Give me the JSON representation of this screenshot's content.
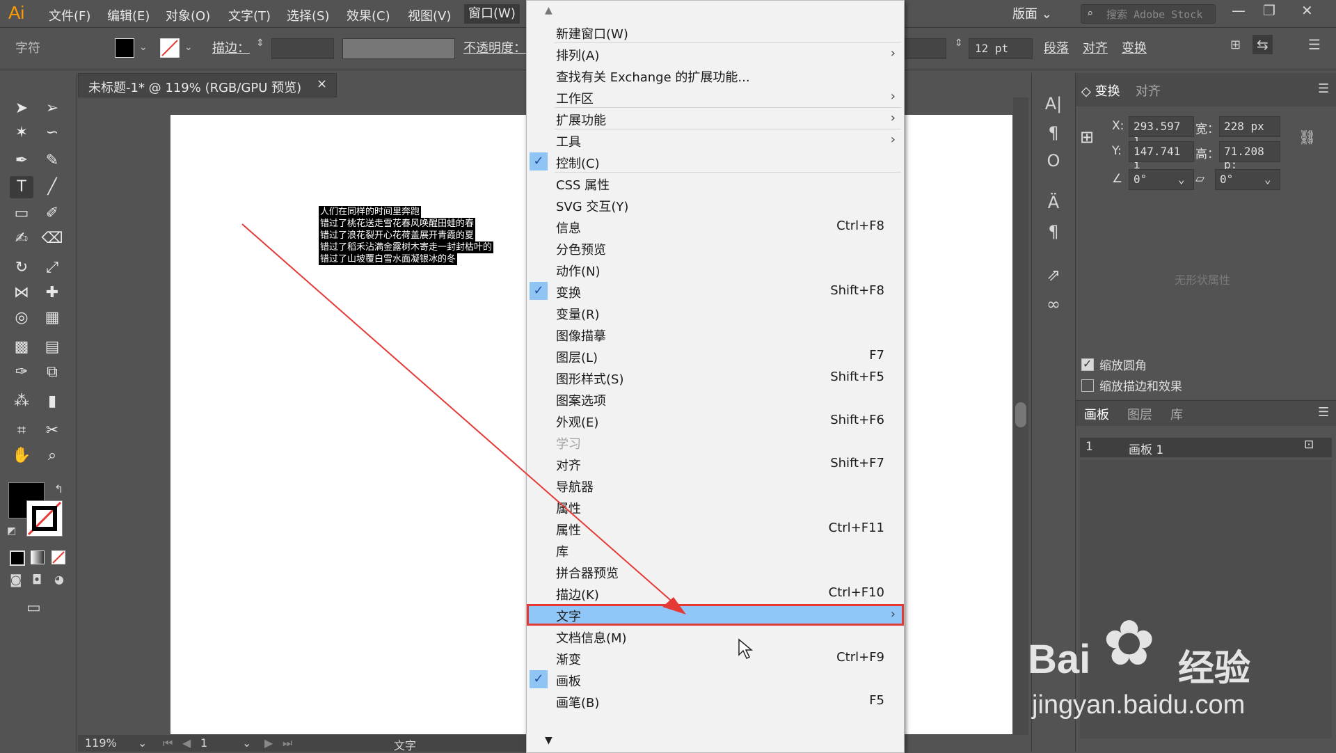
{
  "app": {
    "logo": "Ai",
    "menu": [
      "文件(F)",
      "编辑(E)",
      "对象(O)",
      "文字(T)",
      "选择(S)",
      "效果(C)",
      "视图(V)",
      "窗口(W)"
    ],
    "workspace": "版面",
    "search_placeholder": "搜索 Adobe Stock"
  },
  "control": {
    "char_label": "字符",
    "stroke_label": "描边：",
    "opacity_label": "不透明度：",
    "font_size": "12 pt",
    "paragraph": "段落",
    "align": "对齐",
    "transform": "变换"
  },
  "document": {
    "tab_title": "未标题-1* @ 119% (RGB/GPU 预览)",
    "zoom": "119%",
    "page": "1",
    "status": "文字",
    "poem_lines": [
      "人们在同样的时间里奔跑",
      "错过了桃花送走雪花春风唤醒田蛙的春",
      "错过了浪花裂开心花荷盖展开青霞的夏",
      "错过了稻禾沾满金露树木寄走一封封枯叶的",
      "错过了山坡覆白雪水面凝银冰的冬"
    ]
  },
  "window_menu": {
    "items": [
      {
        "label": "新建窗口(W)",
        "shortcut": "",
        "submenu": false,
        "checked": false
      },
      {
        "label": "排列(A)",
        "shortcut": "",
        "submenu": true,
        "checked": false
      },
      {
        "label": "查找有关 Exchange 的扩展功能...",
        "shortcut": "",
        "submenu": false,
        "checked": false
      },
      {
        "label": "工作区",
        "shortcut": "",
        "submenu": true,
        "checked": false
      },
      {
        "label": "扩展功能",
        "shortcut": "",
        "submenu": true,
        "checked": false
      },
      {
        "label": "工具",
        "shortcut": "",
        "submenu": true,
        "checked": false
      },
      {
        "label": "控制(C)",
        "shortcut": "",
        "submenu": false,
        "checked": true
      },
      {
        "label": "CSS 属性",
        "shortcut": "",
        "submenu": false,
        "checked": false
      },
      {
        "label": "SVG 交互(Y)",
        "shortcut": "",
        "submenu": false,
        "checked": false
      },
      {
        "label": "信息",
        "shortcut": "Ctrl+F8",
        "submenu": false,
        "checked": false
      },
      {
        "label": "分色预览",
        "shortcut": "",
        "submenu": false,
        "checked": false
      },
      {
        "label": "动作(N)",
        "shortcut": "",
        "submenu": false,
        "checked": false
      },
      {
        "label": "变换",
        "shortcut": "Shift+F8",
        "submenu": false,
        "checked": true
      },
      {
        "label": "变量(R)",
        "shortcut": "",
        "submenu": false,
        "checked": false
      },
      {
        "label": "图像描摹",
        "shortcut": "",
        "submenu": false,
        "checked": false
      },
      {
        "label": "图层(L)",
        "shortcut": "F7",
        "submenu": false,
        "checked": false
      },
      {
        "label": "图形样式(S)",
        "shortcut": "Shift+F5",
        "submenu": false,
        "checked": false
      },
      {
        "label": "图案选项",
        "shortcut": "",
        "submenu": false,
        "checked": false
      },
      {
        "label": "外观(E)",
        "shortcut": "Shift+F6",
        "submenu": false,
        "checked": false
      },
      {
        "label": "学习",
        "shortcut": "",
        "submenu": false,
        "checked": false,
        "disabled": true
      },
      {
        "label": "对齐",
        "shortcut": "Shift+F7",
        "submenu": false,
        "checked": false
      },
      {
        "label": "导航器",
        "shortcut": "",
        "submenu": false,
        "checked": false
      },
      {
        "label": "属性",
        "shortcut": "",
        "submenu": false,
        "checked": false
      },
      {
        "label": "属性",
        "shortcut": "Ctrl+F11",
        "submenu": false,
        "checked": false
      },
      {
        "label": "库",
        "shortcut": "",
        "submenu": false,
        "checked": false
      },
      {
        "label": "拼合器预览",
        "shortcut": "",
        "submenu": false,
        "checked": false
      },
      {
        "label": "描边(K)",
        "shortcut": "Ctrl+F10",
        "submenu": false,
        "checked": false
      },
      {
        "label": "文字",
        "shortcut": "",
        "submenu": true,
        "checked": false,
        "highlighted": true
      },
      {
        "label": "文档信息(M)",
        "shortcut": "",
        "submenu": false,
        "checked": false
      },
      {
        "label": "渐变",
        "shortcut": "Ctrl+F9",
        "submenu": false,
        "checked": false
      },
      {
        "label": "画板",
        "shortcut": "",
        "submenu": false,
        "checked": true
      },
      {
        "label": "画笔(B)",
        "shortcut": "F5",
        "submenu": false,
        "checked": false
      }
    ]
  },
  "properties": {
    "tab_transform": "变换",
    "tab_align": "对齐",
    "x_label": "X:",
    "x_value": "293.597 ı",
    "w_label": "宽：",
    "w_value": "228 px",
    "y_label": "Y:",
    "y_value": "147.741 ı",
    "h_label": "高：",
    "h_value": "71.208 p:",
    "angle1": "0°",
    "angle2": "0°",
    "no_shape": "无形状属性",
    "scale_corners": "缩放圆角",
    "scale_strokes": "缩放描边和效果",
    "scale_corners_checked": true,
    "scale_strokes_checked": false
  },
  "artboards_panel": {
    "tabs": [
      "画板",
      "图层",
      "库"
    ],
    "row_index": "1",
    "row_name": "画板 1"
  },
  "watermark": {
    "brand_a": "Bai",
    "brand_b": "经验",
    "url": "jingyan.baidu.com"
  }
}
